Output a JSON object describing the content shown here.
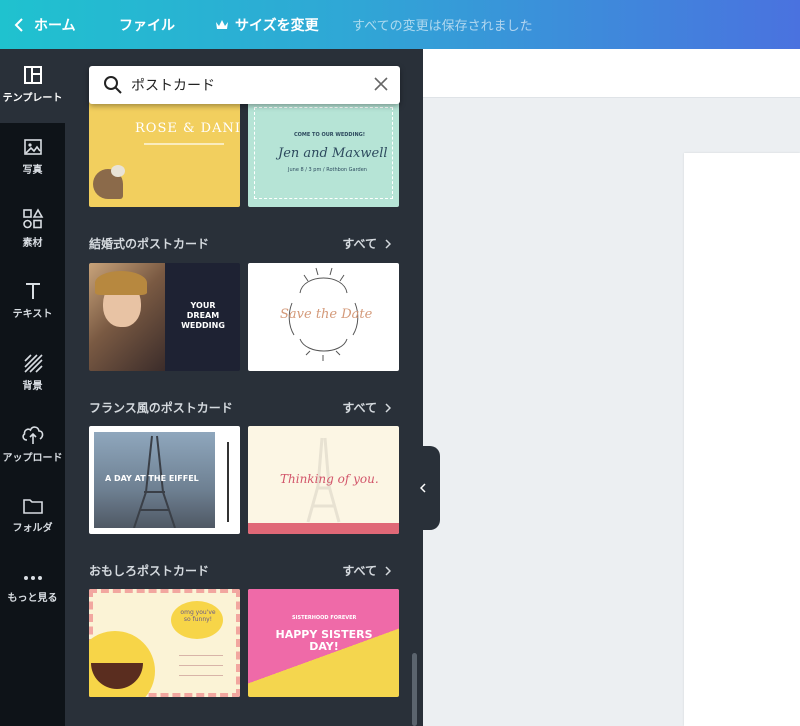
{
  "topbar": {
    "home_label": "ホーム",
    "file_label": "ファイル",
    "resize_label": "サイズを変更",
    "save_status": "すべての変更は保存されました"
  },
  "sidebar": {
    "items": [
      {
        "label": "テンプレート",
        "icon": "template-icon"
      },
      {
        "label": "写真",
        "icon": "photo-icon"
      },
      {
        "label": "素材",
        "icon": "elements-icon"
      },
      {
        "label": "テキスト",
        "icon": "text-icon"
      },
      {
        "label": "背景",
        "icon": "background-icon"
      },
      {
        "label": "アップロード",
        "icon": "upload-icon"
      },
      {
        "label": "フォルダ",
        "icon": "folder-icon"
      },
      {
        "label": "もっと見る",
        "icon": "more-icon"
      }
    ]
  },
  "search": {
    "value": "ポストカード"
  },
  "sections": [
    {
      "title": "結婚式のポストカード",
      "see_all": "すべて"
    },
    {
      "title": "フランス風のポストカード",
      "see_all": "すべて"
    },
    {
      "title": "おもしろポストカード",
      "see_all": "すべて"
    }
  ],
  "templates": {
    "rose_daniel": {
      "title": "ROSE & DANIEL"
    },
    "jen_maxwell": {
      "top": "COME TO OUR WEDDING!",
      "title": "Jen and Maxwell",
      "sub": "June 8 / 3 pm / Rothbon Garden"
    },
    "dream_wedding": {
      "title": "YOUR DREAM WEDDING"
    },
    "save_the_date": {
      "title": "Save the Date"
    },
    "eiffel": {
      "title": "A DAY AT THE EIFFEL"
    },
    "thinking": {
      "title": "Thinking of you."
    },
    "funny": {
      "title": "omg you've so funny!"
    },
    "sisters": {
      "top": "SISTERHOOD FOREVER",
      "title": "HAPPY SISTERS DAY!"
    }
  },
  "colors": {
    "accent_start": "#1fc2cf",
    "accent_end": "#4a72df",
    "rail_bg": "#0e1318",
    "panel_bg": "#293039"
  }
}
